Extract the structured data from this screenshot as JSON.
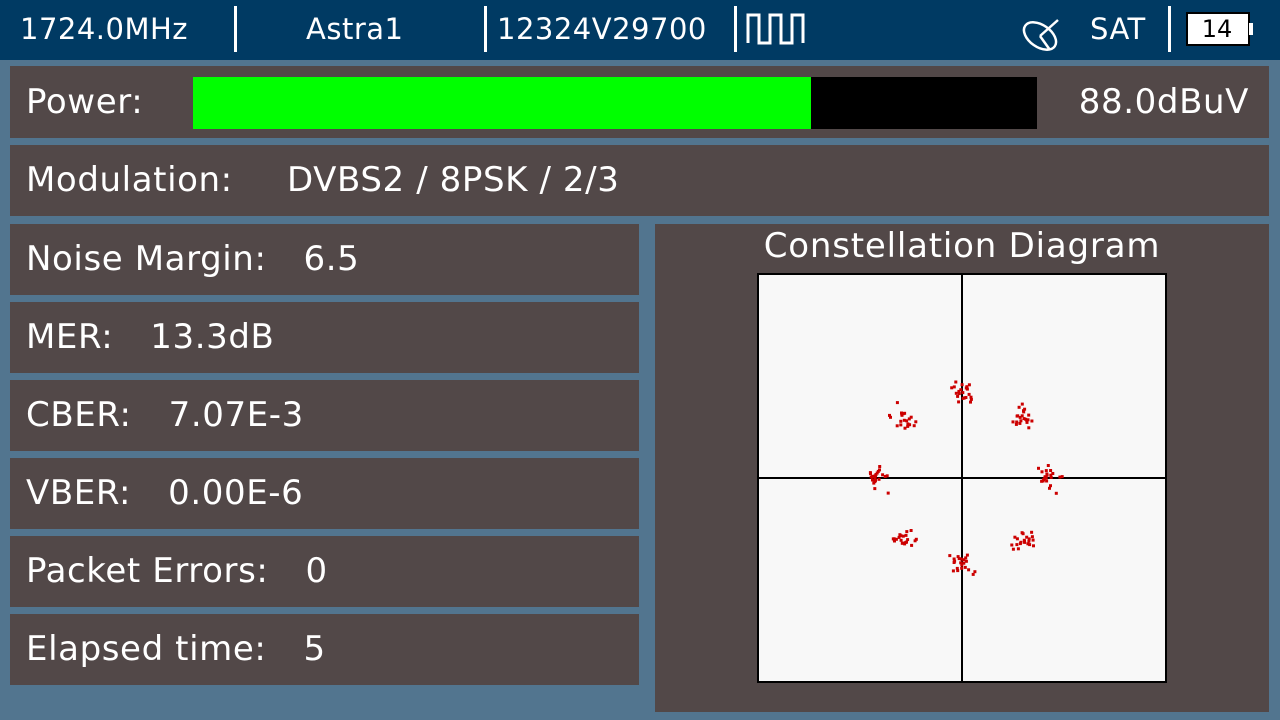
{
  "header": {
    "frequency": "1724.0MHz",
    "satellite": "Astra1",
    "transponder": "12324V29700",
    "signal_icon": "pulse-wave-icon",
    "dish_icon": "satellite-dish-icon",
    "mode": "SAT",
    "battery_level": "14"
  },
  "power": {
    "label": "Power:",
    "value": "88.0dBuV",
    "level_fraction": 0.732,
    "bar_color": "#00ff00"
  },
  "modulation": {
    "label": "Modulation:",
    "value": "DVBS2 / 8PSK / 2/3"
  },
  "measurements": [
    {
      "label": "Noise Margin:",
      "value": "6.5"
    },
    {
      "label": "MER:",
      "value": "13.3dB"
    },
    {
      "label": "CBER:",
      "value": "7.07E-3"
    },
    {
      "label": "VBER:",
      "value": "0.00E-6"
    },
    {
      "label": "Packet Errors:",
      "value": "0"
    },
    {
      "label": "Elapsed time:",
      "value": "5"
    }
  ],
  "constellation": {
    "title": "Constellation Diagram",
    "modulation_points": 8,
    "point_color": "#cc0000",
    "cluster_radius": 0.42,
    "spread": 0.075
  },
  "colors": {
    "header_bg": "#003a63",
    "page_bg": "#52758f",
    "panel_bg": "#524848"
  }
}
